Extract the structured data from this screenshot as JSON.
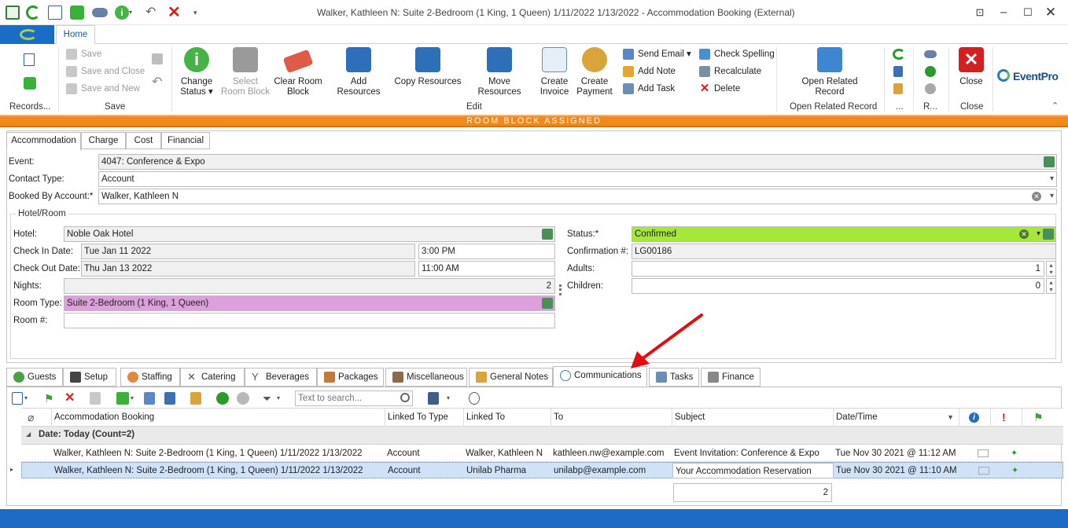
{
  "window": {
    "title": "Walker, Kathleen N: Suite 2-Bedroom (1 King, 1 Queen) 1/11/2022 1/13/2022  - Accommodation Booking (External)"
  },
  "ribbon_tabs": {
    "home": "Home"
  },
  "ribbon": {
    "groups": {
      "records": "Records...",
      "save": "Save",
      "edit": "Edit",
      "open_related": "Open Related Record",
      "more1": "...",
      "r": "R...",
      "close": "Close"
    },
    "save": "Save",
    "save_and_close": "Save and Close",
    "save_and_new": "Save and New",
    "change_status": "Change Status",
    "select_room_block": "Select Room Block",
    "clear_room_block": "Clear Room Block",
    "add_resources": "Add Resources",
    "copy_resources": "Copy Resources",
    "move_resources": "Move Resources",
    "create_invoice": "Create Invoice",
    "create_payment": "Create Payment",
    "send_email": "Send Email",
    "add_note": "Add Note",
    "add_task": "Add Task",
    "check_spelling": "Check Spelling",
    "recalculate": "Recalculate",
    "delete": "Delete",
    "open_related_record": "Open Related Record",
    "close": "Close",
    "logo": "EventPro"
  },
  "banner": "ROOM BLOCK ASSIGNED",
  "top_tabs": [
    "Accommodation",
    "Charge",
    "Cost",
    "Financial"
  ],
  "form": {
    "event_label": "Event:",
    "event_value": "4047: Conference & Expo",
    "contact_type_label": "Contact Type:",
    "contact_type_value": "Account",
    "booked_by_label": "Booked By Account:*",
    "booked_by_value": "Walker, Kathleen N",
    "hotel_room_group": "Hotel/Room",
    "hotel_label": "Hotel:",
    "hotel_value": "Noble Oak Hotel",
    "check_in_label": "Check In Date:",
    "check_in_date": "Tue Jan 11 2022",
    "check_in_time": "3:00 PM",
    "check_out_label": "Check Out Date:",
    "check_out_date": "Thu Jan 13 2022",
    "check_out_time": "11:00 AM",
    "nights_label": "Nights:",
    "nights_value": "2",
    "room_type_label": "Room Type:",
    "room_type_value": "Suite 2-Bedroom (1 King, 1 Queen)",
    "room_no_label": "Room #:",
    "room_no_value": "",
    "status_label": "Status:*",
    "status_value": "Confirmed",
    "confirmation_label": "Confirmation #:",
    "confirmation_value": "LG00186",
    "adults_label": "Adults:",
    "adults_value": "1",
    "children_label": "Children:",
    "children_value": "0"
  },
  "bottom_tabs": [
    "Guests",
    "Setup",
    "Staffing",
    "Catering",
    "Beverages",
    "Packages",
    "Miscellaneous",
    "General Notes",
    "Communications",
    "Tasks",
    "Finance"
  ],
  "search_placeholder": "Text to search...",
  "grid": {
    "columns": [
      "Accommodation Booking",
      "Linked To Type",
      "Linked To",
      "To",
      "Subject",
      "Date/Time"
    ],
    "group_label": "Date: Today (Count=2)",
    "rows": [
      {
        "booking": "Walker, Kathleen N: Suite 2-Bedroom (1 King, 1 Queen) 1/11/2022 1/13/2022",
        "linked_type": "Account",
        "linked_to": "Walker, Kathleen N",
        "to": "kathleen.nw@example.com",
        "subject": "Event Invitation: Conference & Expo",
        "datetime": "Tue Nov 30 2021 @ 11:12 AM"
      },
      {
        "booking": "Walker, Kathleen N: Suite 2-Bedroom (1 King, 1 Queen) 1/11/2022 1/13/2022",
        "linked_type": "Account",
        "linked_to": "Unilab Pharma",
        "to": "unilabp@example.com",
        "subject": "Your Accommodation Reservation",
        "datetime": "Tue Nov 30 2021 @ 11:10 AM"
      }
    ],
    "footer_count": "2"
  },
  "colors": {
    "accent": "#1a6cc4",
    "banner": "#f08a1c",
    "status_green": "#a5e83a",
    "room_type_pink": "#dca0dc",
    "arrow": "#e01010"
  }
}
